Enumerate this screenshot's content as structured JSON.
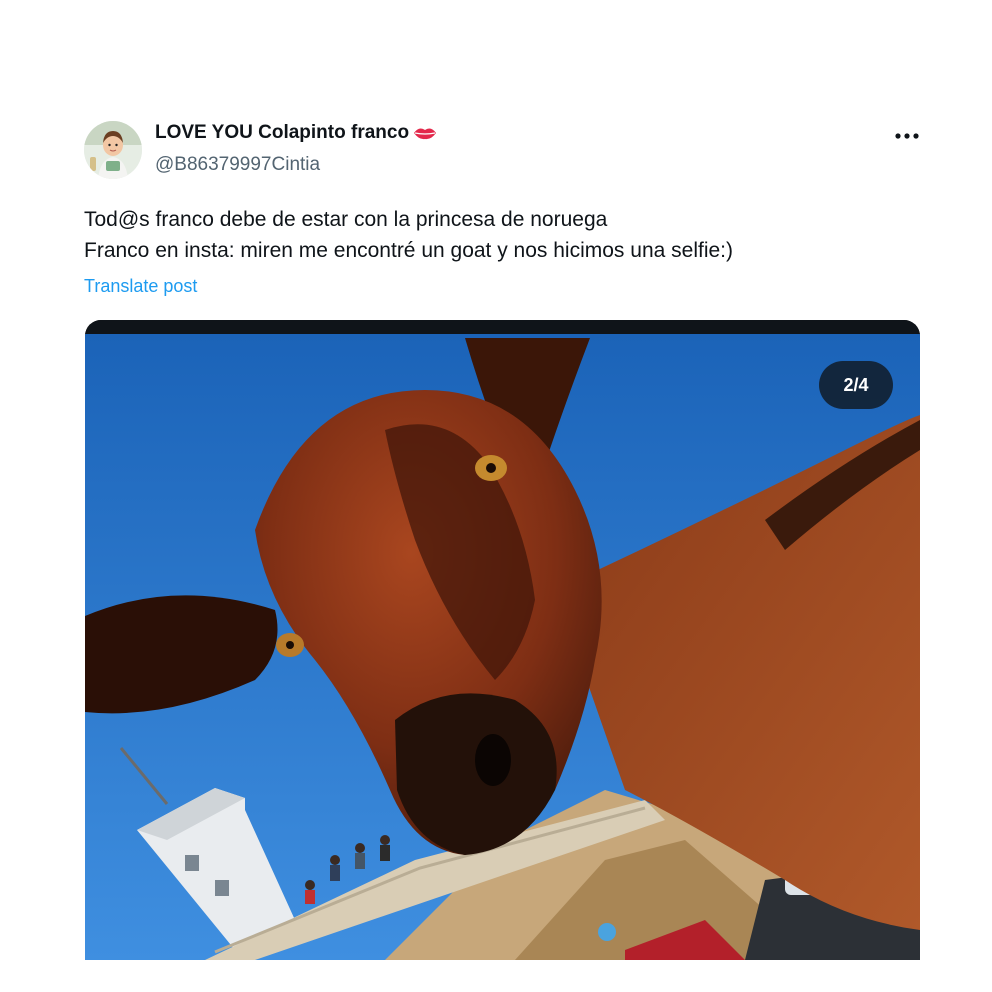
{
  "author": {
    "display_name": "LOVE YOU Colapinto franco",
    "emoji_icon": "lips-icon",
    "handle": "@B86379997Cintia"
  },
  "post": {
    "lines": [
      "Tod@s franco debe de estar con la princesa de noruega",
      "Franco en insta: miren me encontré un goat y nos hicimos una selfie:)"
    ],
    "translate_label": "Translate post"
  },
  "media": {
    "counter": "2/4"
  },
  "colors": {
    "text": "#0f1419",
    "secondary": "#536471",
    "link": "#1d9bf0"
  }
}
